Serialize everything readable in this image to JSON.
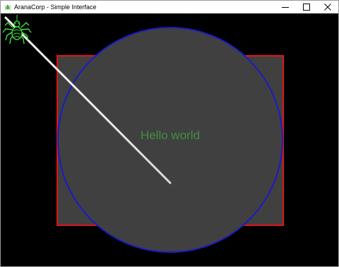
{
  "window": {
    "title": "AranaCorp - Simple Interface",
    "controls": [
      "minimize",
      "maximize",
      "close"
    ]
  },
  "canvas": {
    "background_color": "#000000",
    "text": "Hello world",
    "text_color": "#3f8f3f",
    "rectangle": {
      "fill": "#404040",
      "stroke": "#e01515"
    },
    "circle": {
      "fill": "#404040",
      "stroke": "#1a1ac8"
    },
    "line": {
      "color": "#ffffff"
    },
    "logo_icon": "spider-icon",
    "logo_color": "#3fe03f"
  }
}
